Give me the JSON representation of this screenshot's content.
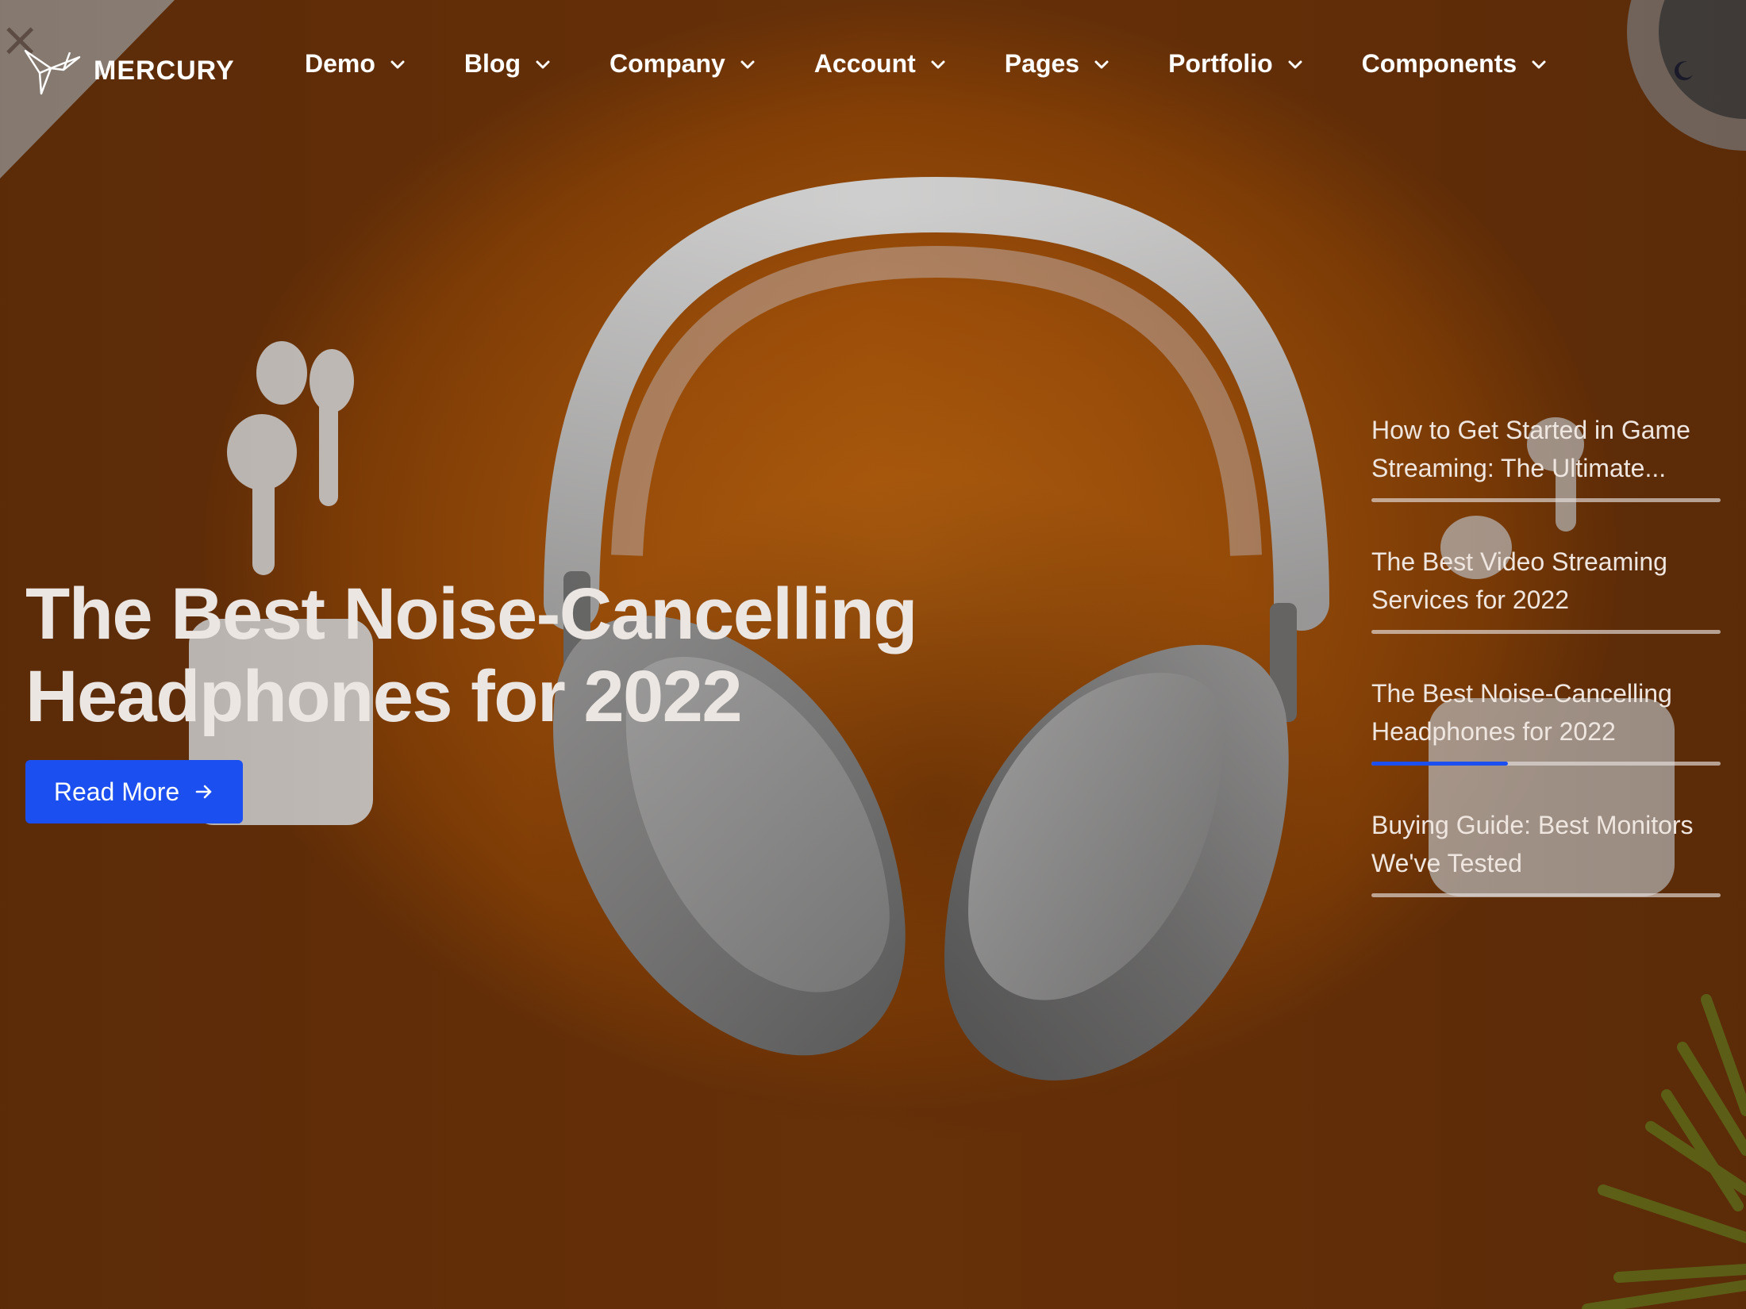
{
  "brand": {
    "name": "MERCURY",
    "logo_icon": "paper-crane-icon"
  },
  "nav": {
    "items": [
      {
        "label": "Demo",
        "icon": "chevron-down-icon"
      },
      {
        "label": "Blog",
        "icon": "chevron-down-icon"
      },
      {
        "label": "Company",
        "icon": "chevron-down-icon"
      },
      {
        "label": "Account",
        "icon": "chevron-down-icon"
      },
      {
        "label": "Pages",
        "icon": "chevron-down-icon"
      },
      {
        "label": "Portfolio",
        "icon": "chevron-down-icon"
      },
      {
        "label": "Components",
        "icon": "chevron-down-icon"
      }
    ],
    "theme_toggle_icon": "moon-icon"
  },
  "hero": {
    "title_line1": "The Best Noise-Cancelling",
    "title_line2": "Headphones for 2022",
    "button_label": "Read More",
    "button_icon": "arrow-right-icon"
  },
  "posts": [
    {
      "line1": "How to Get Started in Game",
      "line2": "Streaming: The Ultimate...",
      "progress": 0
    },
    {
      "line1": "The Best Video Streaming",
      "line2": "Services for 2022",
      "progress": 0
    },
    {
      "line1": "The Best Noise-Cancelling",
      "line2": "Headphones for 2022",
      "progress": 0.39
    },
    {
      "line1": "Buying Guide: Best Monitors",
      "line2": "We've Tested",
      "progress": 0
    }
  ],
  "colors": {
    "background": "#a45209",
    "accent": "#1b4ff0",
    "text": "#ffffff"
  }
}
